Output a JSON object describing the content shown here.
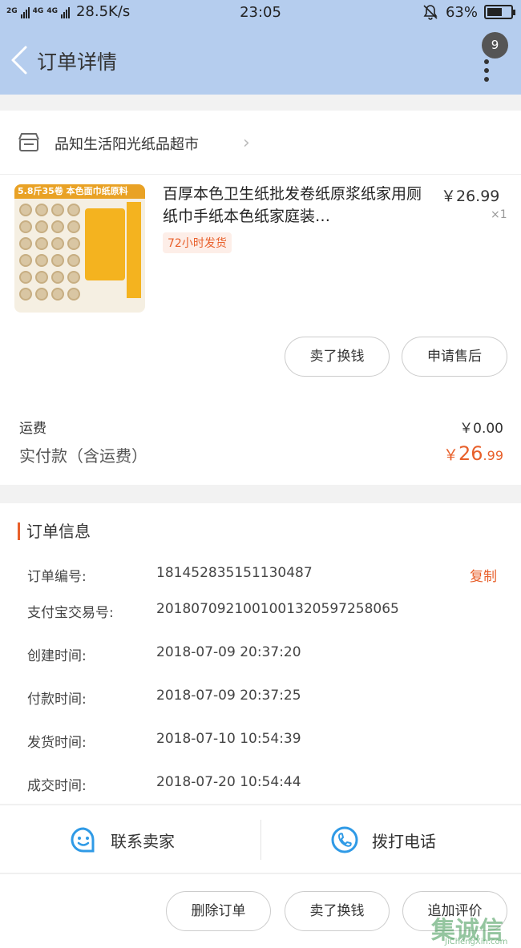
{
  "status_bar": {
    "signal_left": "2G",
    "signal_mid": "4G",
    "signal_mid2": "4G",
    "net_speed": "28.5K/s",
    "time": "23:05",
    "battery": "63%",
    "battery_level": 0.63
  },
  "nav": {
    "title": "订单详情",
    "notification_count": "9"
  },
  "shop": {
    "name": "品知生活阳光纸品超市"
  },
  "product": {
    "thumb_banner": "5.8斤35卷  本色面巾纸原料",
    "title": "百厚本色卫生纸批发卷纸原浆纸家用厕纸巾手纸本色纸家庭装…",
    "price": "￥26.99",
    "quantity": "×1",
    "shipping_tag": "72小时发货"
  },
  "item_actions": {
    "sell_label": "卖了换钱",
    "aftersale_label": "申请售后"
  },
  "fees": {
    "shipping_label": "运费",
    "shipping_value": "￥0.00",
    "paid_label": "实付款（含运费）",
    "paid_currency": "￥",
    "paid_int": "26",
    "paid_dec": ".99"
  },
  "order_info": {
    "heading": "订单信息",
    "copy_label": "复制",
    "rows": [
      {
        "label": "订单编号:",
        "value": "181452835151130487"
      },
      {
        "label": "支付宝交易号:",
        "value": "2018070921001001320597258065"
      },
      {
        "label": "创建时间:",
        "value": "2018-07-09 20:37:20"
      },
      {
        "label": "付款时间:",
        "value": "2018-07-09 20:37:25"
      },
      {
        "label": "发货时间:",
        "value": "2018-07-10 10:54:39"
      },
      {
        "label": "成交时间:",
        "value": "2018-07-20 10:54:44"
      }
    ]
  },
  "contact": {
    "seller_label": "联系卖家",
    "call_label": "拨打电话"
  },
  "footer": {
    "delete_label": "删除订单",
    "sell_label": "卖了换钱",
    "review_label": "追加评价"
  },
  "watermark": {
    "text": "集诚信",
    "sub": "JiChengXin.com"
  },
  "colors": {
    "header_bg": "#b5cdee",
    "accent": "#e8602b",
    "icon_blue": "#2f9ae6"
  }
}
